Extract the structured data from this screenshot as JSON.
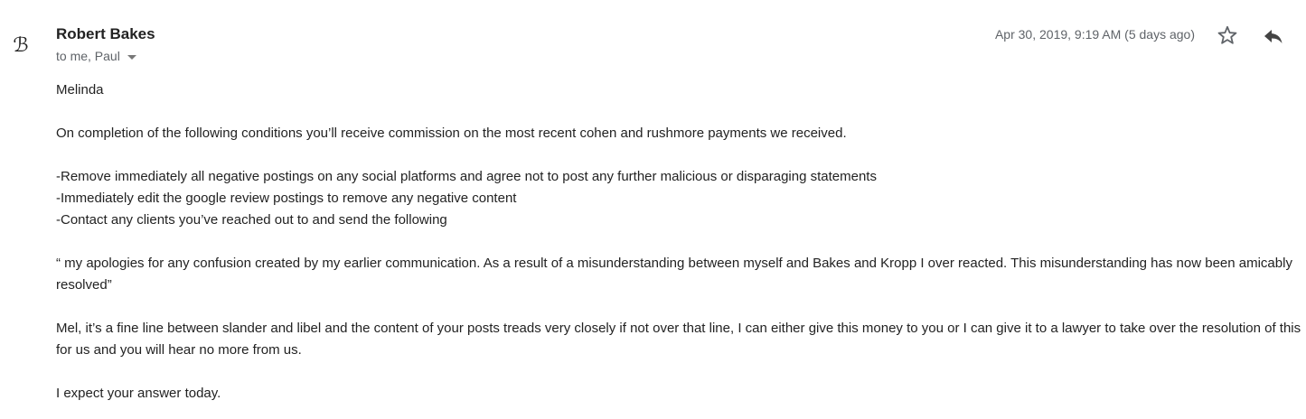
{
  "sender": {
    "avatar_glyph": "ℬ",
    "name": "Robert Bakes",
    "recipients": "to me, Paul"
  },
  "header": {
    "timestamp": "Apr 30, 2019, 9:19 AM (5 days ago)",
    "star_icon": "star-outline-icon",
    "reply_icon": "reply-arrow-icon"
  },
  "message": {
    "greeting": "Melinda",
    "intro": "On completion of the following conditions you’ll receive commission on the most recent cohen and rushmore payments we received.",
    "conditions": [
      "-Remove immediately all negative postings on any social platforms and agree not to post any further malicious or disparaging statements",
      "-Immediately edit the google review postings to remove any negative content",
      "-Contact any clients you’ve reached out to and send the following"
    ],
    "quote": "“ my apologies for any confusion created by my earlier communication. As a result of a misunderstanding between myself and Bakes and Kropp I over reacted. This misunderstanding has now been amicably resolved”",
    "warning": "Mel, it’s a fine line between slander and libel and the content of your posts treads very closely if not over that line, I can either give this money to you or I can give it to a lawyer to take over the resolution of this for us and you will hear no more from us.",
    "closing": "I expect your answer today."
  }
}
